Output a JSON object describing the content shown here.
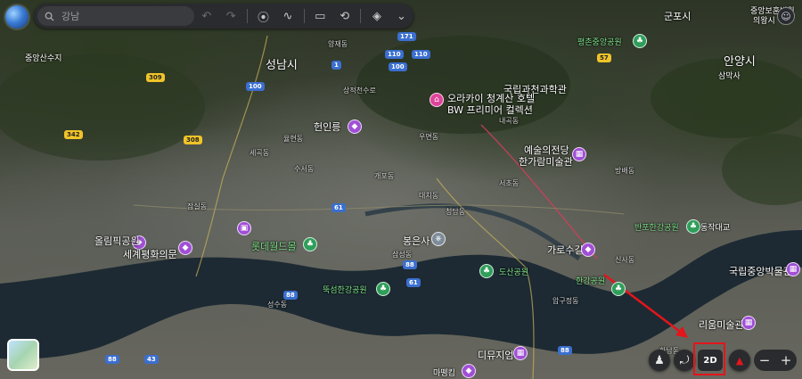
{
  "search": {
    "placeholder": "강남"
  },
  "toolbar": {
    "undo_icon": "↶",
    "redo_icon": "↷",
    "pin_icon": "⦿",
    "path_icon": "∿",
    "ruler_icon": "▭",
    "history_icon": "⟲",
    "layers_icon": "◈",
    "expand_icon": "⌄"
  },
  "controls": {
    "label_2d": "2D",
    "pegman_icon": "♟",
    "rotate_icon": "⤾",
    "compass_icon": "▲",
    "zoom_out": "−",
    "zoom_in": "+"
  },
  "accent": {
    "highlight": "#e4151b",
    "arrow": "#e4151b"
  },
  "map": {
    "places": [
      {
        "text": "성남시",
        "cls": "big"
      },
      {
        "text": "군포시",
        "cls": "mid"
      },
      {
        "text": "안양시",
        "cls": "big"
      },
      {
        "text": "중앙보훈병원"
      },
      {
        "text": "의왕시"
      },
      {
        "text": "삼막사"
      },
      {
        "text": "국립과천과학관",
        "cls": "mid"
      },
      {
        "text": "오라카이 청계산 호텔",
        "cls": "mid"
      },
      {
        "text": "BW 프리미어 컬렉션",
        "cls": "mid"
      },
      {
        "text": "헌인릉",
        "cls": "mid"
      },
      {
        "text": "예술의전당",
        "cls": "mid"
      },
      {
        "text": "한가람미술관",
        "cls": "mid"
      },
      {
        "text": "올림픽공원",
        "cls": "mid"
      },
      {
        "text": "세계평화의문",
        "cls": "mid"
      },
      {
        "text": "롯데월드몰",
        "cls": "mid"
      },
      {
        "text": "봉은사",
        "cls": "mid"
      },
      {
        "text": "도산공원",
        "cls": "green"
      },
      {
        "text": "뚝섬한강공원",
        "cls": "green"
      },
      {
        "text": "한강공원",
        "cls": "green"
      },
      {
        "text": "가로수길",
        "cls": "mid"
      },
      {
        "text": "반포한강공원",
        "cls": "green"
      },
      {
        "text": "동작대교"
      },
      {
        "text": "국립중앙박물관",
        "cls": "mid"
      },
      {
        "text": "리움미술관",
        "cls": "mid"
      },
      {
        "text": "디뮤지엄",
        "cls": "mid"
      },
      {
        "text": "마뗑킴"
      },
      {
        "text": "평촌중앙공원",
        "cls": "green"
      },
      {
        "text": "상적천수로"
      },
      {
        "text": "중앙산수지"
      },
      {
        "text": "양재동"
      },
      {
        "text": "잠실동"
      },
      {
        "text": "삼성동"
      },
      {
        "text": "청담동"
      },
      {
        "text": "압구정동"
      },
      {
        "text": "신사동"
      },
      {
        "text": "서초동"
      },
      {
        "text": "개포동"
      },
      {
        "text": "대치동"
      },
      {
        "text": "수서동"
      },
      {
        "text": "율현동"
      },
      {
        "text": "세곡동"
      },
      {
        "text": "우면동"
      },
      {
        "text": "내곡동"
      },
      {
        "text": "방배동"
      },
      {
        "text": "성수동"
      },
      {
        "text": "한남동"
      }
    ],
    "road_shields": [
      "309",
      "342",
      "308",
      "100",
      "100",
      "171",
      "110",
      "110",
      "1",
      "57",
      "61",
      "88",
      "88",
      "61",
      "88",
      "43",
      "88"
    ]
  }
}
